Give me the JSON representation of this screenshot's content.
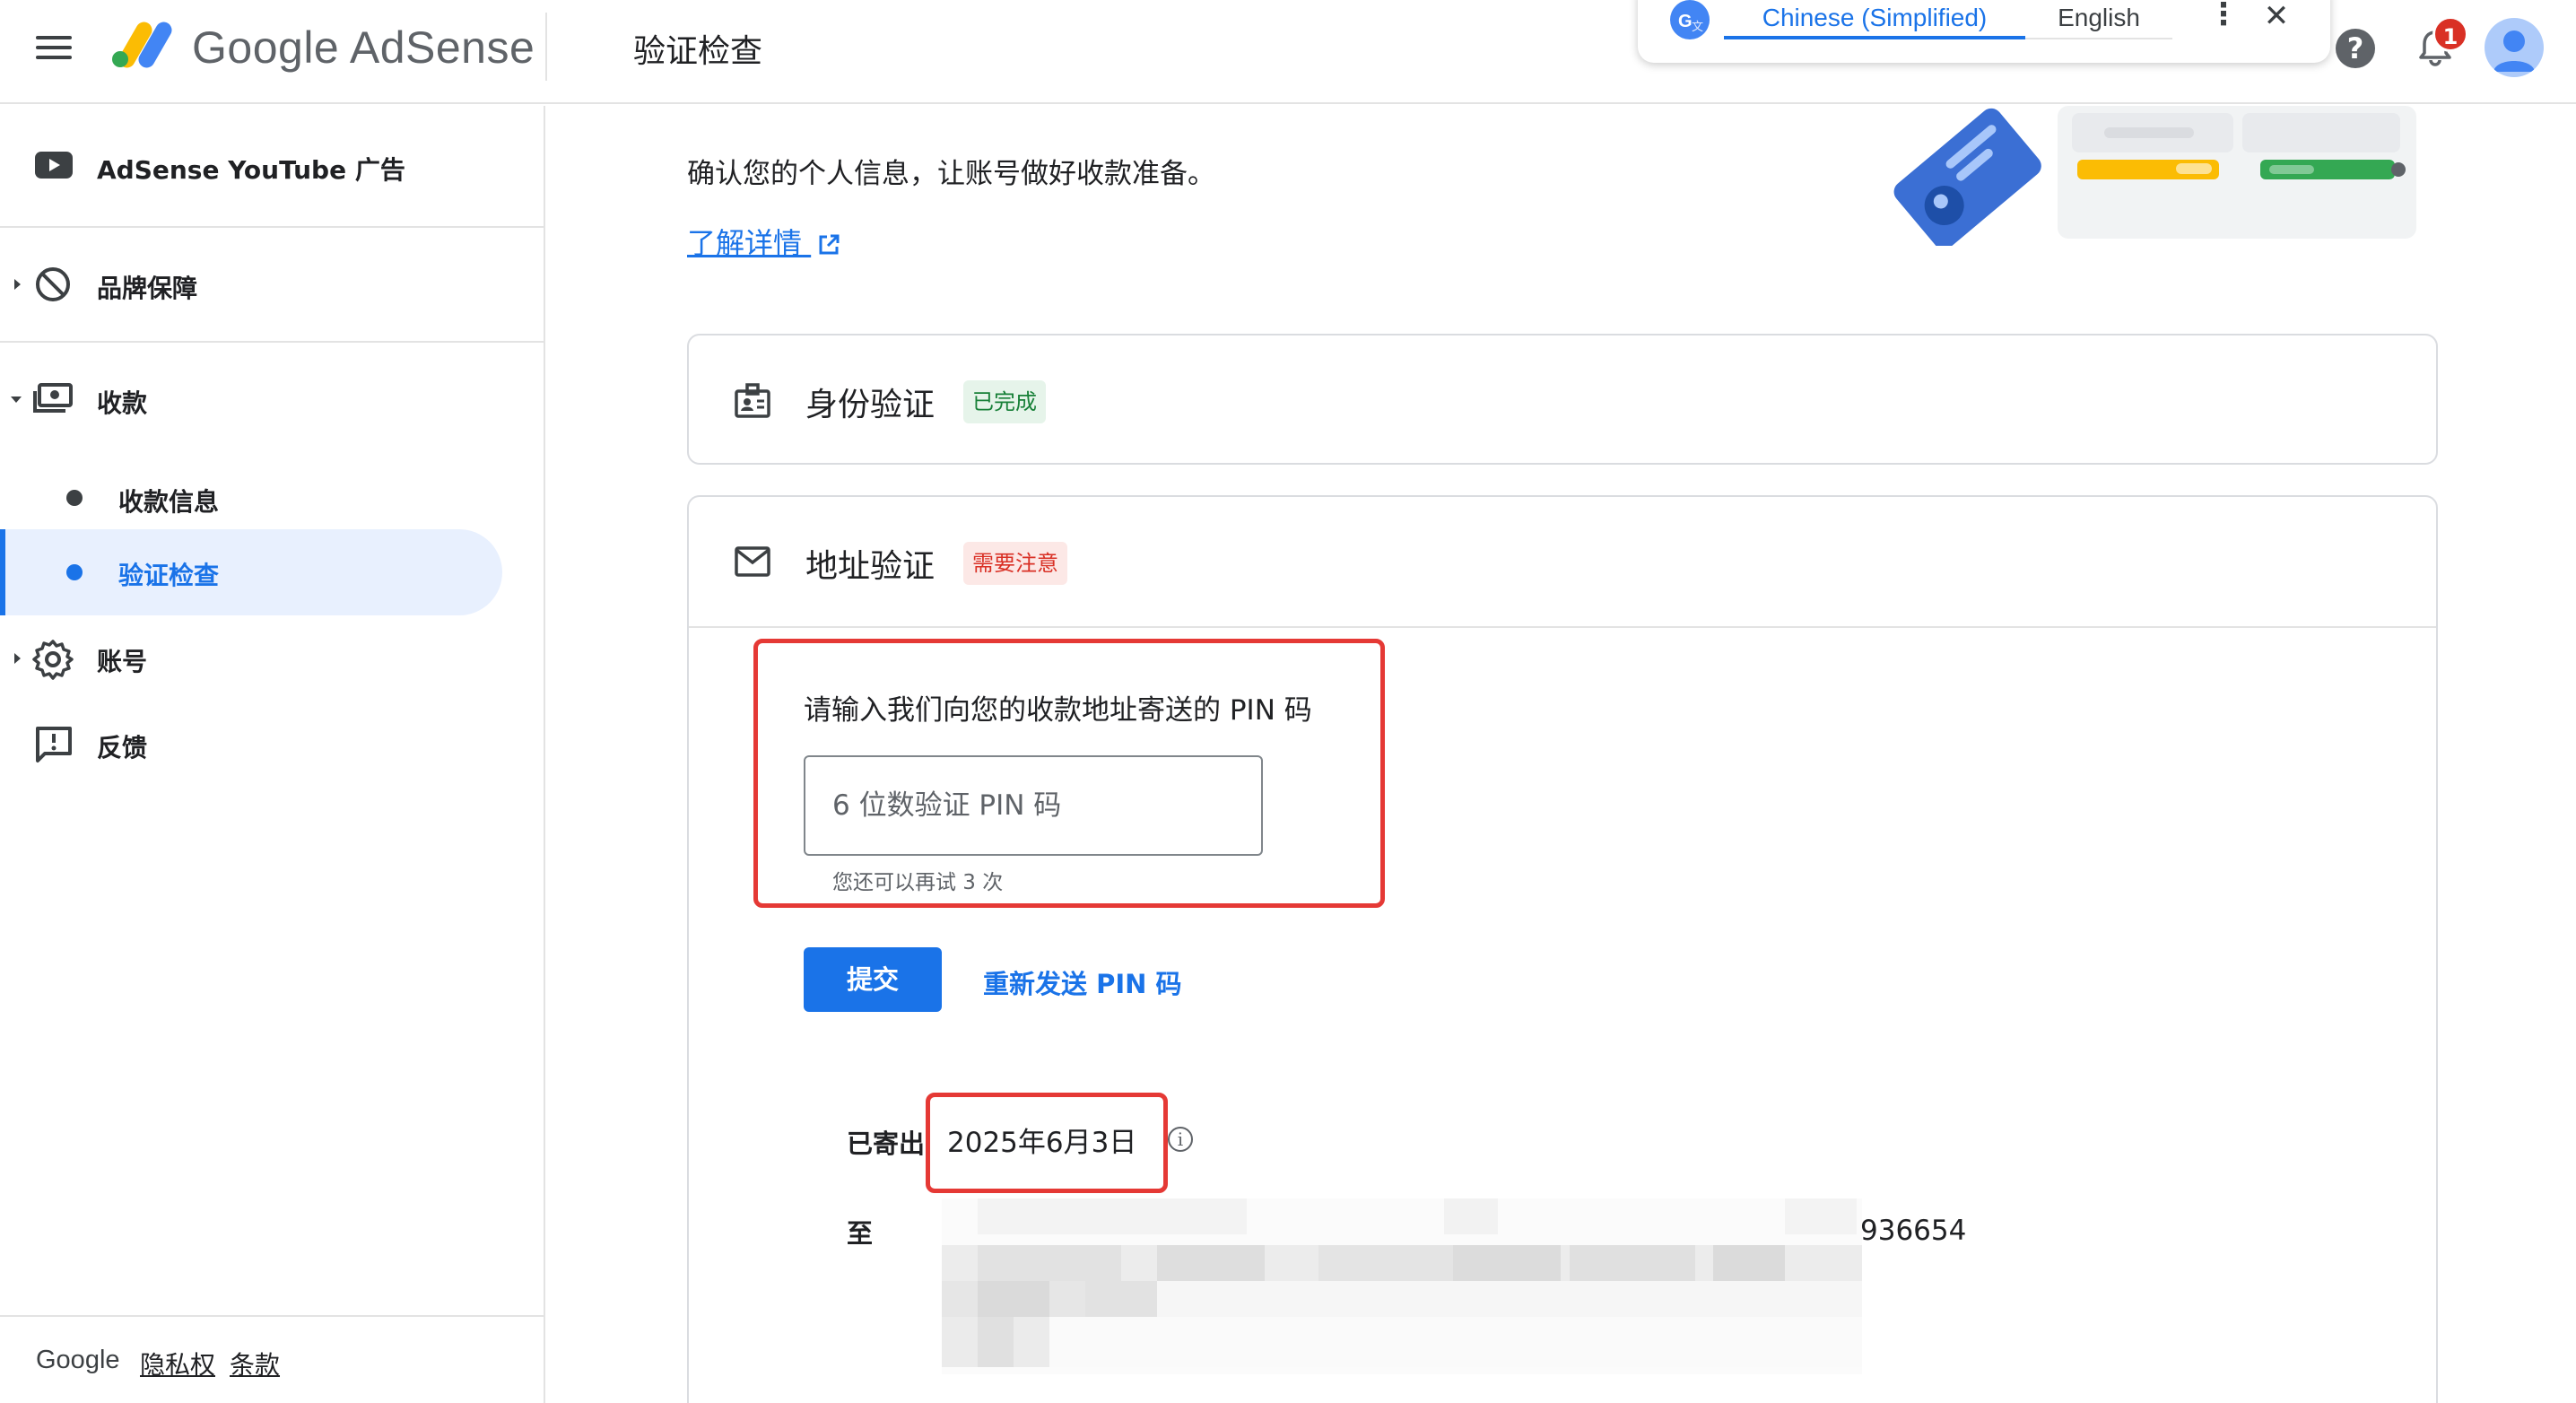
{
  "header": {
    "brand": "Google AdSense",
    "page_title": "验证检查"
  },
  "translate_bar": {
    "tab_source": "Chinese (Simplified)",
    "tab_target": "English",
    "more": "⋮",
    "close": "✕"
  },
  "notifications": {
    "badge": "1"
  },
  "help": {
    "label": "?"
  },
  "sidebar": {
    "items": [
      {
        "label": "AdSense YouTube 广告"
      },
      {
        "label": "品牌保障"
      },
      {
        "label": "收款"
      },
      {
        "label": "收款信息"
      },
      {
        "label": "验证检查"
      },
      {
        "label": "账号"
      },
      {
        "label": "反馈"
      }
    ],
    "footer": {
      "google": "Google",
      "privacy": "隐私权",
      "terms": "条款"
    }
  },
  "main": {
    "intro": "确认您的个人信息，让账号做好收款准备。",
    "learn_more": "了解详情",
    "identity": {
      "title": "身份验证",
      "status": "已完成"
    },
    "address": {
      "title": "地址验证",
      "status": "需要注意",
      "pin_prompt": "请输入我们向您的收款地址寄送的 PIN 码",
      "pin_placeholder": "6 位数验证 PIN 码",
      "retry_text": "您还可以再试 3 次",
      "submit": "提交",
      "resend": "重新发送 PIN 码",
      "sent_label": "已寄出",
      "sent_date": "2025年6月3日",
      "to_label": "至",
      "zip": "936654"
    }
  },
  "colors": {
    "accent": "#1a73e8",
    "success": "#188038",
    "error": "#d93025",
    "highlight_box": "#e53935"
  }
}
